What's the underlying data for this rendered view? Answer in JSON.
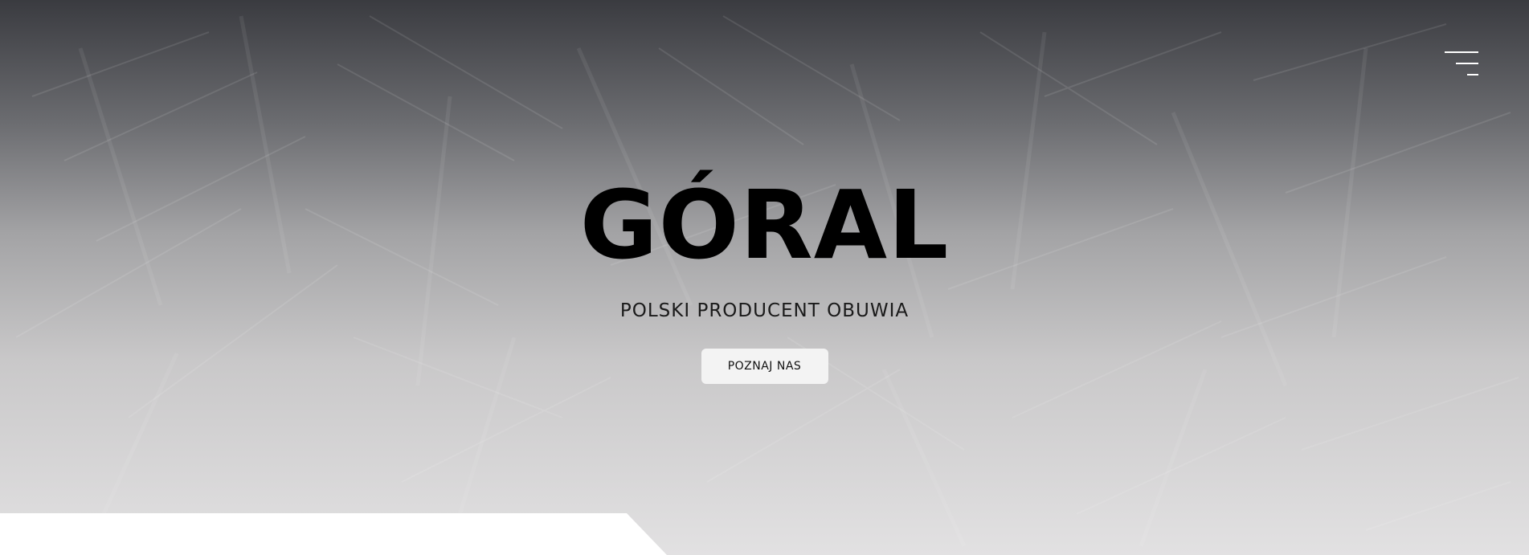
{
  "header": {
    "menu_icon": "hamburger-menu-icon"
  },
  "hero": {
    "title": "GÓRAL",
    "subtitle": "POLSKI PRODUCENT OBUWIA",
    "cta_label": "POZNAJ NAS"
  },
  "colors": {
    "gradient_top": "#3a3b40",
    "gradient_bottom": "#e2e1e2",
    "title": "#000000",
    "button_bg": "#f3f3f3",
    "menu_icon": "#ffffff"
  }
}
